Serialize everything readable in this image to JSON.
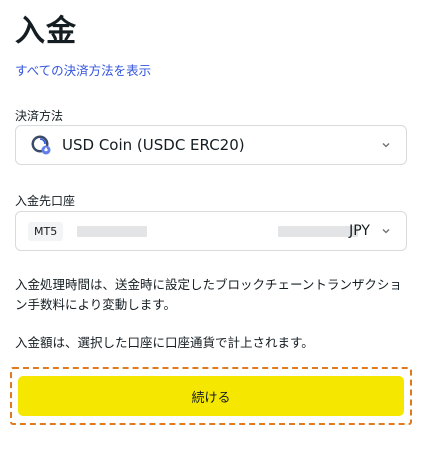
{
  "page": {
    "title": "入金",
    "show_all_link": "すべての決済方法を表示"
  },
  "payment_method": {
    "label": "決済方法",
    "selected": "USD Coin (USDC ERC20)",
    "icon": "usdc-coin-icon"
  },
  "deposit_account": {
    "label": "入金先口座",
    "platform": "MT5",
    "currency": "JPY"
  },
  "info": {
    "processing_time": "入金処理時間は、送金時に設定したブロックチェーントランザクション手数料により変動します。",
    "credit_note": "入金額は、選択した口座に口座通貨で計上されます。"
  },
  "actions": {
    "continue_label": "続ける"
  },
  "colors": {
    "accent_button": "#f5e700",
    "link": "#3355dd",
    "highlight_border": "#e07a1f"
  }
}
